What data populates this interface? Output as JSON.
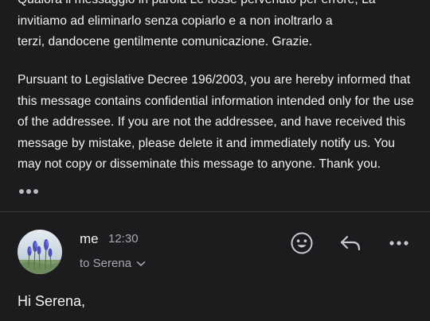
{
  "previous_message": {
    "italian_disclaimer": "Qualora il messaggio in parola Le fosse pervenuto per errore, La\ninvitiamo ad eliminarlo senza copiarlo e a non inoltrarlo a\nterzi, dandocene gentilmente comunicazione. Grazie.",
    "english_disclaimer": "Pursuant to Legislative Decree 196/2003, you are hereby informed that\nthis message contains confidential information intended only for the use\nof the addressee. If you are not the addressee, and have received this\nmessage by mistake, please delete it and immediately notify us. You\nmay not copy or disseminate this message to anyone. Thank you.",
    "show_more_icon": "ellipsis-icon"
  },
  "reply_message": {
    "sender": "me",
    "time": "12:30",
    "recipient": "to Serena",
    "recipient_icon": "chevron-down-icon",
    "greeting": "Hi Serena,",
    "actions": {
      "emoji_icon": "smiley-icon",
      "reply_icon": "reply-arrow-icon",
      "more_icon": "more-horizontal-icon"
    }
  },
  "colors": {
    "background": "#1c1c1e",
    "text_primary": "#f3f3f5",
    "text_secondary": "#a9a9ae",
    "divider": "#3a3a3d"
  }
}
